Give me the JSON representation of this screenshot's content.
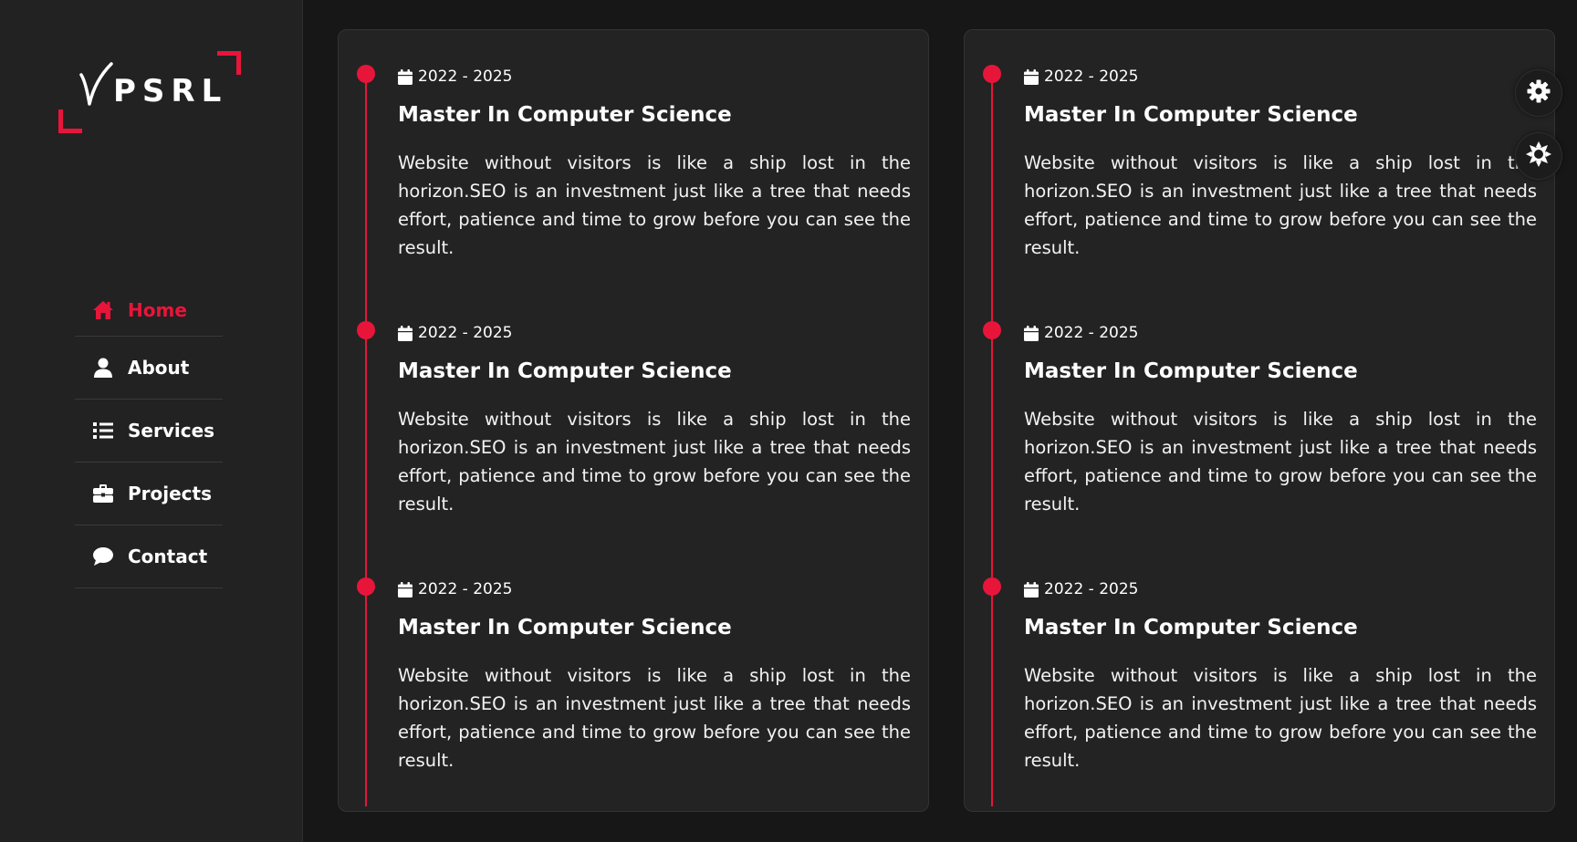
{
  "brand": {
    "logo_text": "PSRL",
    "accent_color": "#e8153a"
  },
  "nav": {
    "items": [
      {
        "label": "Home",
        "icon": "home-icon",
        "active": true
      },
      {
        "label": "About",
        "icon": "user-icon",
        "active": false
      },
      {
        "label": "Services",
        "icon": "list-icon",
        "active": false
      },
      {
        "label": "Projects",
        "icon": "briefcase-icon",
        "active": false
      },
      {
        "label": "Contact",
        "icon": "chat-icon",
        "active": false
      }
    ]
  },
  "columns": [
    {
      "entries": [
        {
          "date": "2022 - 2025",
          "title": "Master In Computer Science",
          "description": "Website without visitors is like a ship lost in the horizon.SEO is an investment just like a tree that needs effort, patience and time to grow before you can see the result."
        },
        {
          "date": "2022 - 2025",
          "title": "Master In Computer Science",
          "description": "Website without visitors is like a ship lost in the horizon.SEO is an investment just like a tree that needs effort, patience and time to grow before you can see the result."
        },
        {
          "date": "2022 - 2025",
          "title": "Master In Computer Science",
          "description": "Website without visitors is like a ship lost in the horizon.SEO is an investment just like a tree that needs effort, patience and time to grow before you can see the result."
        }
      ]
    },
    {
      "entries": [
        {
          "date": "2022 - 2025",
          "title": "Master In Computer Science",
          "description": "Website without visitors is like a ship lost in the horizon.SEO is an investment just like a tree that needs effort, patience and time to grow before you can see the result."
        },
        {
          "date": "2022 - 2025",
          "title": "Master In Computer Science",
          "description": "Website without visitors is like a ship lost in the horizon.SEO is an investment just like a tree that needs effort, patience and time to grow before you can see the result."
        },
        {
          "date": "2022 - 2025",
          "title": "Master In Computer Science",
          "description": "Website without visitors is like a ship lost in the horizon.SEO is an investment just like a tree that needs effort, patience and time to grow before you can see the result."
        }
      ]
    }
  ],
  "floating_buttons": [
    {
      "icon": "gear-icon"
    },
    {
      "icon": "sun-icon"
    }
  ]
}
